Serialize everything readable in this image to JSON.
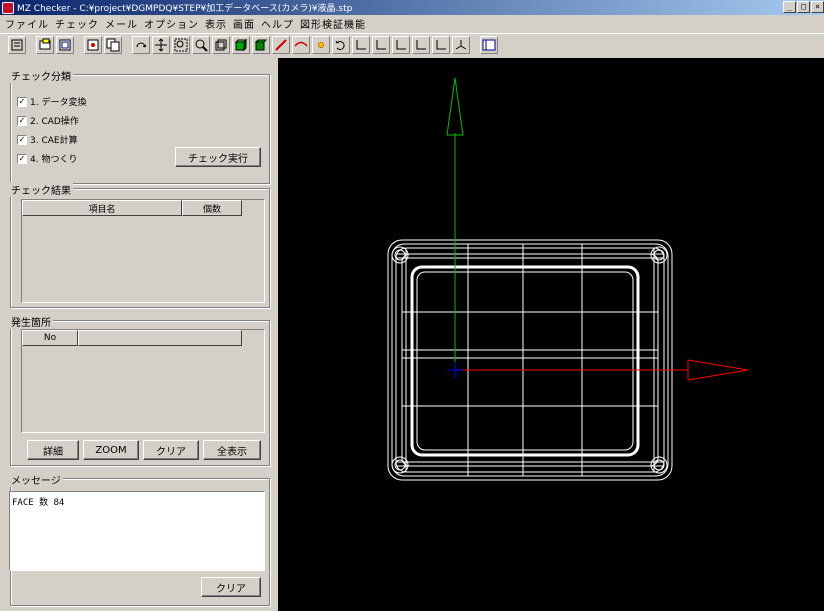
{
  "window": {
    "title": "MZ Checker - C:¥project¥DGMPDQ¥STEP¥加工データベース(カメラ)¥液晶.stp",
    "minimize_label": "_",
    "maximize_label": "□",
    "close_label": "×"
  },
  "menu": {
    "items": [
      "ファイル",
      "チェック",
      "メール",
      "オプション",
      "表示",
      "画面",
      "ヘルプ",
      "図形検証機能"
    ]
  },
  "toolbar": {
    "icons": [
      "print-icon",
      "open-icon",
      "window-icon",
      "export-icon",
      "copy-icon",
      "rotate-icon",
      "pan-icon",
      "zoom-window-icon",
      "zoom-icon",
      "fit-icon",
      "shade-icon",
      "solid-icon",
      "line-icon",
      "curve-icon",
      "point-icon",
      "undo-view-icon",
      "axis-x-icon",
      "axis-y-icon",
      "axis-z-icon",
      "axis-neg-z-icon",
      "axis-neg-x-icon",
      "iso-icon",
      "panel-icon"
    ]
  },
  "check_category": {
    "title": "チェック分類",
    "items": [
      {
        "label": "1. データ変換",
        "checked": true
      },
      {
        "label": "2. CAD操作",
        "checked": true
      },
      {
        "label": "3. CAE計算",
        "checked": true
      },
      {
        "label": "4. 物つくり",
        "checked": true
      }
    ],
    "run_button": "チェック実行"
  },
  "check_result": {
    "title": "チェック結果",
    "col_item": "項目名",
    "col_count": "個数"
  },
  "occurrence": {
    "title": "発生箇所",
    "col_no": "No",
    "buttons": {
      "detail": "詳細",
      "zoom": "ZOOM",
      "clear": "クリア",
      "show_all": "全表示"
    }
  },
  "message": {
    "title": "メッセージ",
    "text": "FACE 数 84",
    "clear_button": "クリア"
  },
  "viewport": {
    "background": "#000000",
    "axis_colors": {
      "x": "#ff0000",
      "y": "#00c000",
      "z": "#0000ff"
    },
    "model_color": "#ffffff"
  }
}
